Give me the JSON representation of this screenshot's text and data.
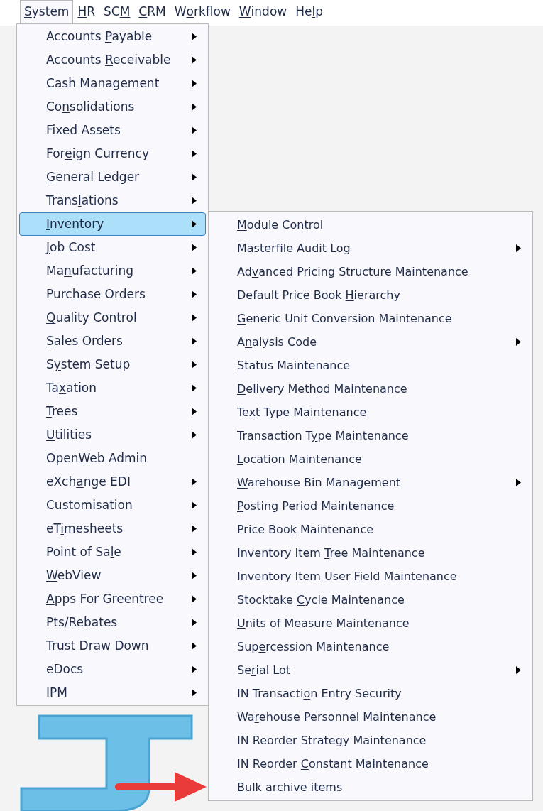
{
  "menu_bar": [
    {
      "label": {
        "key": "S",
        "after": "ystem"
      },
      "selected": true
    },
    {
      "label": {
        "key": "H",
        "after": "R"
      },
      "selected": false
    },
    {
      "label": {
        "before": "SC",
        "key": "M"
      },
      "selected": false
    },
    {
      "label": {
        "key": "C",
        "after": "RM"
      },
      "selected": false
    },
    {
      "label": {
        "before": "W",
        "key": "o",
        "after": "rkflow"
      },
      "selected": false
    },
    {
      "label": {
        "key": "W",
        "after": "indow"
      },
      "selected": false
    },
    {
      "label": {
        "before": "He",
        "key": "l",
        "after": "p"
      },
      "selected": false
    }
  ],
  "system_menu": [
    {
      "label": {
        "before": "Accounts ",
        "key": "P",
        "after": "ayable"
      },
      "has_submenu": true,
      "selected": false
    },
    {
      "label": {
        "before": "Accounts ",
        "key": "R",
        "after": "eceivable"
      },
      "has_submenu": true,
      "selected": false
    },
    {
      "label": {
        "key": "C",
        "after": "ash Management"
      },
      "has_submenu": true,
      "selected": false
    },
    {
      "label": {
        "before": "Co",
        "key": "n",
        "after": "solidations"
      },
      "has_submenu": true,
      "selected": false
    },
    {
      "label": {
        "key": "F",
        "after": "ixed Assets"
      },
      "has_submenu": true,
      "selected": false
    },
    {
      "label": {
        "before": "For",
        "key": "e",
        "after": "ign Currency"
      },
      "has_submenu": true,
      "selected": false
    },
    {
      "label": {
        "key": "G",
        "after": "eneral Ledger"
      },
      "has_submenu": true,
      "selected": false
    },
    {
      "label": {
        "before": "Trans",
        "key": "l",
        "after": "ations"
      },
      "has_submenu": true,
      "selected": false
    },
    {
      "label": {
        "key": "I",
        "after": "nventory"
      },
      "has_submenu": true,
      "selected": true
    },
    {
      "label": {
        "key": "J",
        "after": "ob Cost"
      },
      "has_submenu": true,
      "selected": false
    },
    {
      "label": {
        "before": "Ma",
        "key": "n",
        "after": "ufacturing"
      },
      "has_submenu": true,
      "selected": false
    },
    {
      "label": {
        "before": "Purc",
        "key": "h",
        "after": "ase Orders"
      },
      "has_submenu": true,
      "selected": false
    },
    {
      "label": {
        "key": "Q",
        "after": "uality Control"
      },
      "has_submenu": true,
      "selected": false
    },
    {
      "label": {
        "key": "S",
        "after": "ales Orders"
      },
      "has_submenu": true,
      "selected": false
    },
    {
      "label": {
        "before": "S",
        "key": "y",
        "after": "stem Setup"
      },
      "has_submenu": true,
      "selected": false
    },
    {
      "label": {
        "before": "Ta",
        "key": "x",
        "after": "ation"
      },
      "has_submenu": true,
      "selected": false
    },
    {
      "label": {
        "key": "T",
        "after": "rees"
      },
      "has_submenu": true,
      "selected": false
    },
    {
      "label": {
        "key": "U",
        "after": "tilities"
      },
      "has_submenu": true,
      "selected": false
    },
    {
      "label": {
        "before": "Open",
        "key": "W",
        "after": "eb Admin"
      },
      "has_submenu": false,
      "selected": false
    },
    {
      "label": {
        "before": "eXch",
        "key": "a",
        "after": "nge EDI"
      },
      "has_submenu": true,
      "selected": false
    },
    {
      "label": {
        "before": "Custo",
        "key": "m",
        "after": "isation"
      },
      "has_submenu": true,
      "selected": false
    },
    {
      "label": {
        "before": "eT",
        "key": "i",
        "after": "mesheets"
      },
      "has_submenu": true,
      "selected": false
    },
    {
      "label": {
        "before": "Point of Sa",
        "key": "l",
        "after": "e"
      },
      "has_submenu": true,
      "selected": false
    },
    {
      "label": {
        "key": "W",
        "after": "ebView"
      },
      "has_submenu": true,
      "selected": false
    },
    {
      "label": {
        "key": "A",
        "after": "pps For Greentree"
      },
      "has_submenu": true,
      "selected": false
    },
    {
      "label": {
        "before": "Pts/Rebates"
      },
      "has_submenu": true,
      "selected": false
    },
    {
      "label": {
        "before": "Trust Draw Down"
      },
      "has_submenu": true,
      "selected": false
    },
    {
      "label": {
        "key": "e",
        "after": "Docs"
      },
      "has_submenu": true,
      "selected": false
    },
    {
      "label": {
        "before": "IPM"
      },
      "has_submenu": true,
      "selected": false
    }
  ],
  "inventory_menu": [
    {
      "label": {
        "key": "M",
        "after": "odule Control"
      },
      "has_submenu": false
    },
    {
      "label": {
        "before": "Masterfile ",
        "key": "A",
        "after": "udit Log"
      },
      "has_submenu": true
    },
    {
      "label": {
        "before": "Ad",
        "key": "v",
        "after": "anced Pricing Structure Maintenance"
      },
      "has_submenu": false
    },
    {
      "label": {
        "before": "Default Price Book ",
        "key": "H",
        "after": "ierarchy"
      },
      "has_submenu": false
    },
    {
      "label": {
        "key": "G",
        "after": "eneric Unit Conversion Maintenance"
      },
      "has_submenu": false
    },
    {
      "label": {
        "before": "A",
        "key": "n",
        "after": "alysis Code"
      },
      "has_submenu": true
    },
    {
      "label": {
        "key": "S",
        "after": "tatus Maintenance"
      },
      "has_submenu": false
    },
    {
      "label": {
        "key": "D",
        "after": "elivery Method Maintenance"
      },
      "has_submenu": false
    },
    {
      "label": {
        "before": "Te",
        "key": "x",
        "after": "t Type Maintenance"
      },
      "has_submenu": false
    },
    {
      "label": {
        "before": "Transaction T",
        "key": "y",
        "after": "pe Maintenance"
      },
      "has_submenu": false
    },
    {
      "label": {
        "key": "L",
        "after": "ocation Maintenance"
      },
      "has_submenu": false
    },
    {
      "label": {
        "key": "W",
        "after": "arehouse Bin Management"
      },
      "has_submenu": true
    },
    {
      "label": {
        "key": "P",
        "after": "osting Period Maintenance"
      },
      "has_submenu": false
    },
    {
      "label": {
        "before": "Price Boo",
        "key": "k",
        "after": " Maintenance"
      },
      "has_submenu": false
    },
    {
      "label": {
        "before": "Inventory Item ",
        "key": "T",
        "after": "ree Maintenance"
      },
      "has_submenu": false
    },
    {
      "label": {
        "before": "Inventory Item User ",
        "key": "F",
        "after": "ield Maintenance"
      },
      "has_submenu": false
    },
    {
      "label": {
        "before": "Stocktake ",
        "key": "C",
        "after": "ycle Maintenance"
      },
      "has_submenu": false
    },
    {
      "label": {
        "key": "U",
        "after": "nits of Measure Maintenance"
      },
      "has_submenu": false
    },
    {
      "label": {
        "before": "Sup",
        "key": "e",
        "after": "rcession Maintenance"
      },
      "has_submenu": false
    },
    {
      "label": {
        "before": "Se",
        "key": "r",
        "after": "ial Lot"
      },
      "has_submenu": true
    },
    {
      "label": {
        "before": "IN Transacti",
        "key": "o",
        "after": "n Entry Security"
      },
      "has_submenu": false
    },
    {
      "label": {
        "before": "Wa",
        "key": "r",
        "after": "ehouse Personnel Maintenance"
      },
      "has_submenu": false
    },
    {
      "label": {
        "before": "IN Reorder ",
        "key": "S",
        "after": "trategy Maintenance"
      },
      "has_submenu": false
    },
    {
      "label": {
        "before": "IN Reorder ",
        "key": "C",
        "after": "onstant Maintenance"
      },
      "has_submenu": false
    },
    {
      "label": {
        "key": "B",
        "after": "ulk archive items"
      },
      "has_submenu": false
    }
  ]
}
